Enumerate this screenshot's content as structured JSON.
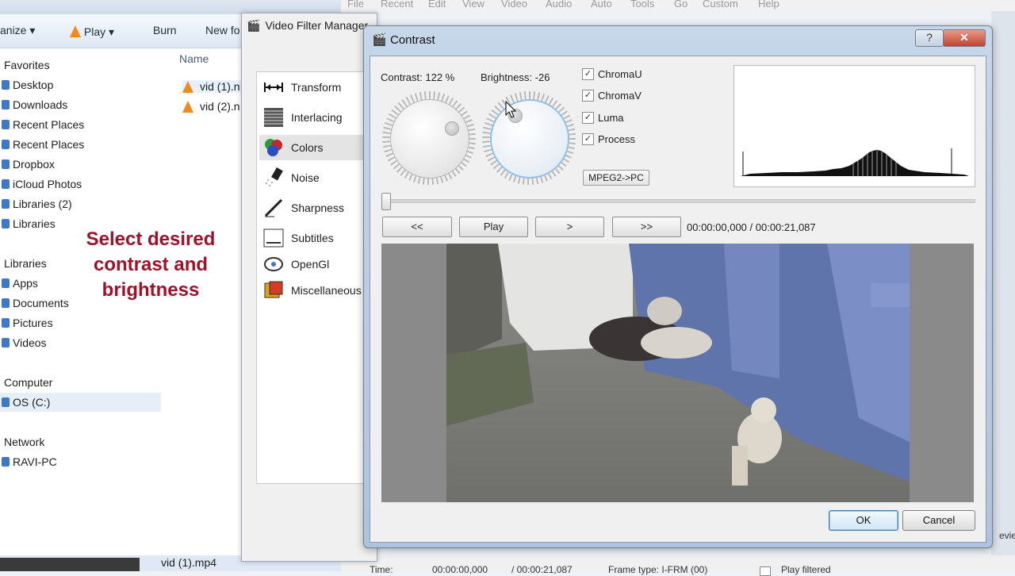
{
  "explorer": {
    "toolbar": {
      "organize": "anize",
      "play": "Play",
      "burn": "Burn",
      "new_folder": "New fo"
    },
    "favorites_header": "Favorites",
    "favorites": [
      "Desktop",
      "Downloads",
      "Recent Places",
      "Recent Places",
      "Dropbox",
      "iCloud Photos",
      "Libraries (2)",
      "Libraries"
    ],
    "libraries_header": "Libraries",
    "libraries": [
      "Apps",
      "Documents",
      "Pictures",
      "Videos"
    ],
    "computer_header": "Computer",
    "computer_items": [
      "OS (C:)"
    ],
    "network_header": "Network",
    "network_items": [
      "RAVI-PC"
    ],
    "column_name": "Name",
    "files": [
      "vid (1).n",
      "vid (2).n"
    ],
    "taskbar_label": "vid (1).mp4"
  },
  "annotation": {
    "line1": "Select desired",
    "line2": "contrast and",
    "line3": "brightness"
  },
  "avidemux": {
    "menu": [
      "File",
      "Recent",
      "Edit",
      "View",
      "Video",
      "Audio",
      "Auto",
      "Tools",
      "Go",
      "Custom",
      "Help"
    ],
    "status": {
      "time_label": "Time:",
      "time_value": "00:00:00,000",
      "duration": "/ 00:00:21,087",
      "frame_type": "Frame type: I-FRM (00)",
      "filtered": "Play filtered",
      "review": "eview"
    }
  },
  "filter_manager": {
    "title": "Video Filter Manager",
    "categories": [
      "Transform",
      "Interlacing",
      "Colors",
      "Noise",
      "Sharpness",
      "Subtitles",
      "OpenGl",
      "Miscellaneous"
    ],
    "selected": "Colors"
  },
  "contrast_dialog": {
    "title": "Contrast",
    "help_glyph": "?",
    "close_glyph": "✕",
    "contrast_label": "Contrast:",
    "contrast_value": "122 %",
    "brightness_label": "Brightness:",
    "brightness_value": "-26",
    "checkboxes": [
      {
        "label": "ChromaU",
        "checked": true
      },
      {
        "label": "ChromaV",
        "checked": true
      },
      {
        "label": "Luma",
        "checked": true
      },
      {
        "label": "Process",
        "checked": true
      }
    ],
    "mpeg_button": "MPEG2->PC",
    "nav": {
      "rewind": "<<",
      "play": "Play",
      "next": ">",
      "forward": ">>"
    },
    "time_display": "00:00:00,000 / 00:00:21,087",
    "ok": "OK",
    "cancel": "Cancel"
  },
  "colors": {
    "annotation": "#a0102a",
    "accent": "#3c7fb1",
    "vlc_orange": "#f08a1c"
  }
}
